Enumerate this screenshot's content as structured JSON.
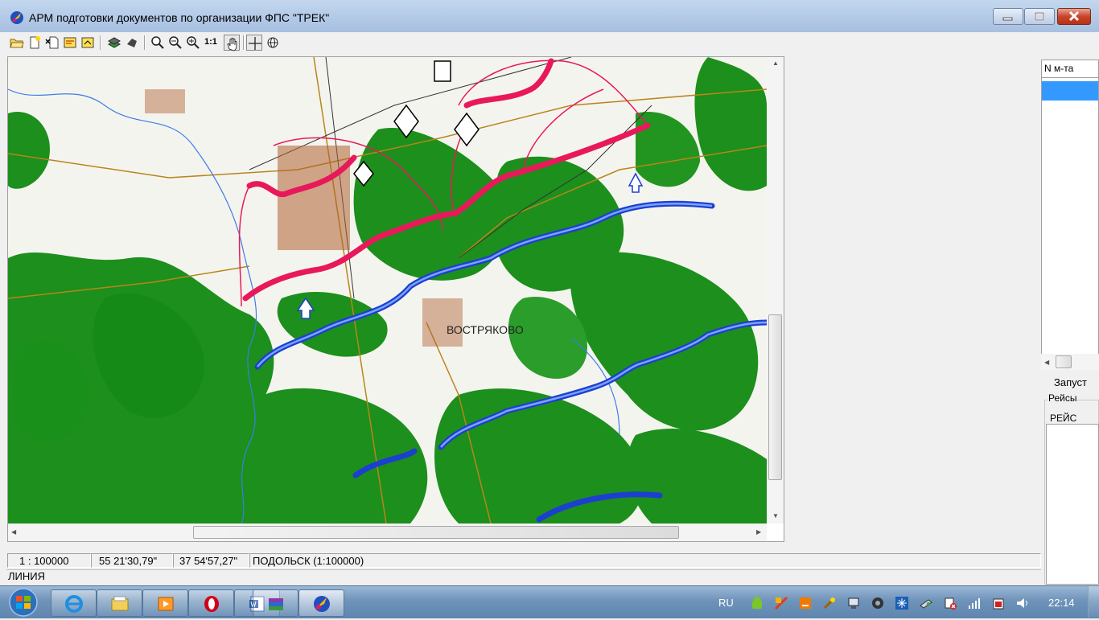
{
  "window": {
    "title": "АРМ подготовки документов по организации ФПС \"ТРЕК\""
  },
  "toolbar": {
    "tools": [
      "open-icon",
      "new-doc-icon",
      "delete-doc-icon",
      "doc-edit-icon",
      "doc-export-icon",
      "layers-icon",
      "style-icon",
      "zoom-in-icon",
      "zoom-out-icon",
      "zoom-fit-icon",
      "scale-1-1-icon",
      "pan-hand-icon",
      "crosshair-icon",
      "globe-icon"
    ],
    "scale_button": "1:1"
  },
  "map": {
    "place_label": "ВОСТРЯКОВО",
    "colors": {
      "forest": "#1c8f1c",
      "land": "#f4f4ef",
      "red_line": "#e8195a",
      "blue_line": "#1d3fd0"
    }
  },
  "right_panel": {
    "column_header": "N м-та",
    "launch_button": "Запуст",
    "flights_group": "Рейсы",
    "flights_header": "РЕЙС"
  },
  "status": {
    "scale": "1 : 100000",
    "latitude": "55 21'30,79\"",
    "longitude": "37 54'57,27\"",
    "map_name": "ПОДОЛЬСК (1:100000)",
    "mode": "ЛИНИЯ"
  },
  "taskbar": {
    "apps": [
      "internet-explorer-icon",
      "explorer-folder-icon",
      "media-player-icon",
      "opera-icon",
      "word-icon",
      "archive-icon",
      "trek-app-icon"
    ],
    "language": "RU",
    "time": "22:14"
  }
}
